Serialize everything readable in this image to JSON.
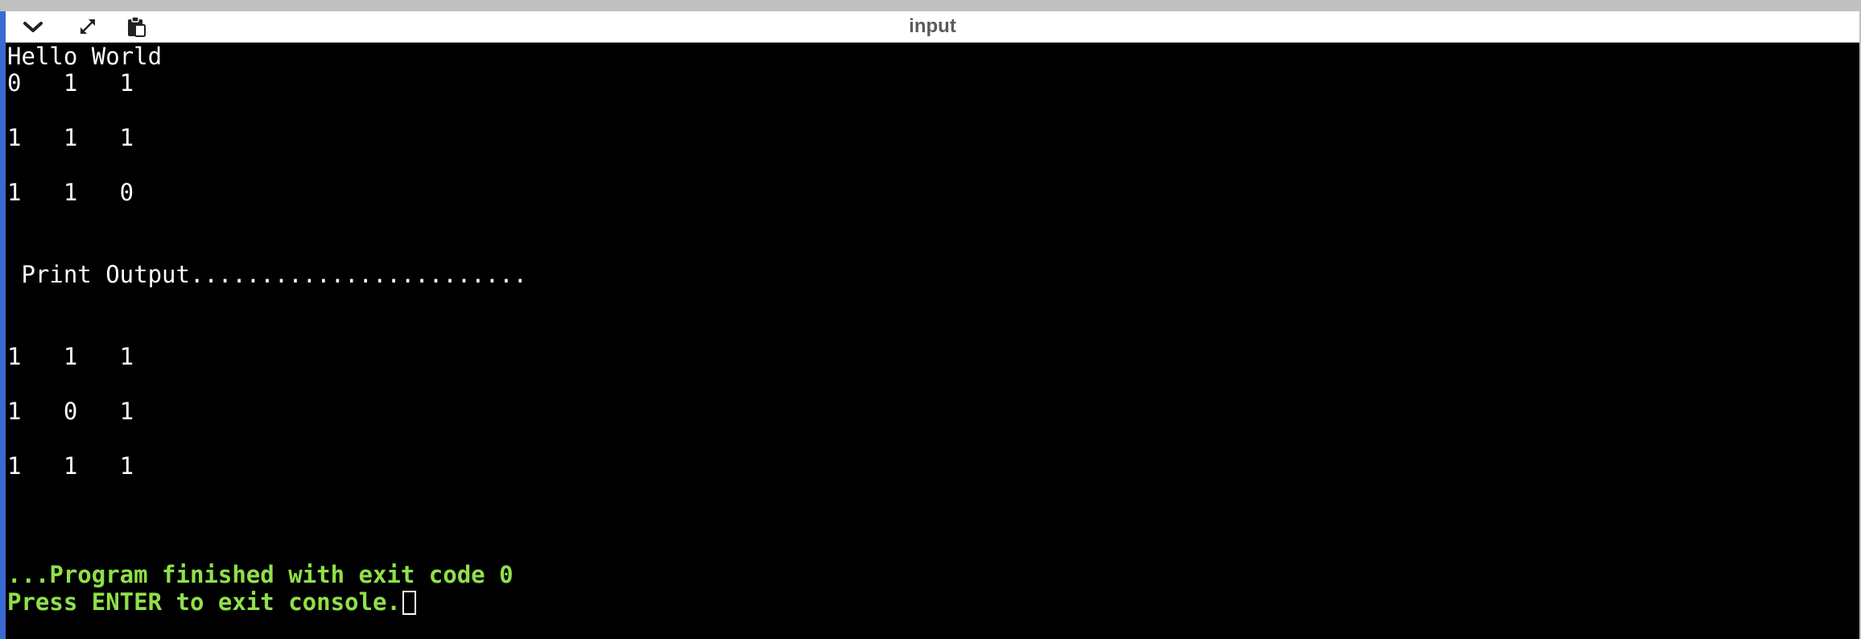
{
  "window": {
    "title": "input"
  },
  "toolbar": {
    "buttons": [
      {
        "icon": "chevron-down-icon"
      },
      {
        "icon": "expand-icon"
      },
      {
        "icon": "clipboard-icon"
      }
    ]
  },
  "console": {
    "lines": [
      "Hello World",
      "0   1   1",
      "1   1   1",
      "1   1   0",
      " Print Output........................",
      "1   1   1",
      "1   0   1",
      "1   1   1"
    ],
    "exit_message": "...Program finished with exit code 0",
    "prompt": "Press ENTER to exit console."
  },
  "colors": {
    "background": "#000000",
    "text": "#ffffff",
    "status_text": "#8fe04a",
    "title_text": "#5b5b5b"
  }
}
